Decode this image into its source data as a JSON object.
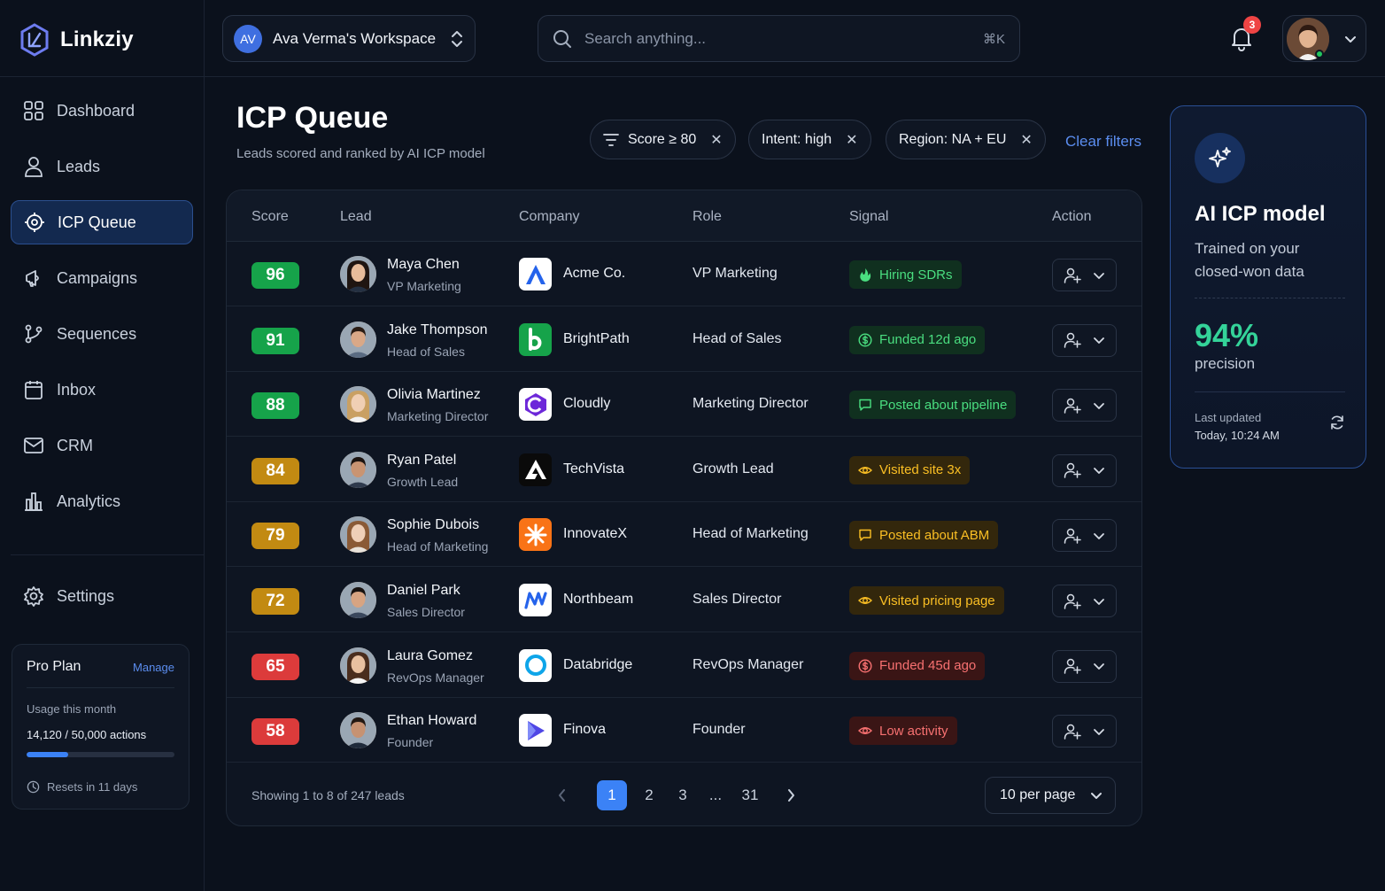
{
  "brand": {
    "name": "Linkziy"
  },
  "workspace": {
    "initials": "AV",
    "name": "Ava Verma's Workspace"
  },
  "search": {
    "placeholder": "Search anything...",
    "shortcut": "⌘K"
  },
  "notifications": {
    "count": "3"
  },
  "nav": {
    "items": [
      {
        "label": "Dashboard",
        "icon": "grid-icon"
      },
      {
        "label": "Leads",
        "icon": "user-icon"
      },
      {
        "label": "ICP Queue",
        "icon": "target-icon",
        "active": true
      },
      {
        "label": "Campaigns",
        "icon": "megaphone-icon"
      },
      {
        "label": "Sequences",
        "icon": "branch-icon"
      },
      {
        "label": "Inbox",
        "icon": "calendar-icon"
      },
      {
        "label": "CRM",
        "icon": "mail-icon"
      },
      {
        "label": "Analytics",
        "icon": "bar-chart-icon"
      }
    ],
    "settings": "Settings"
  },
  "plan": {
    "title": "Pro Plan",
    "manage": "Manage",
    "usage_label": "Usage this month",
    "usage": "14,120 / 50,000 actions",
    "usage_fraction": 0.2824,
    "reset": "Resets in 11 days"
  },
  "page": {
    "title": "ICP Queue",
    "subtitle": "Leads scored and ranked by AI ICP model"
  },
  "filters": {
    "chips": [
      "Score ≥ 80",
      "Intent: high",
      "Region: NA + EU"
    ],
    "clear": "Clear filters"
  },
  "table": {
    "headers": [
      "Score",
      "Lead",
      "Company",
      "Role",
      "Signal",
      "Action"
    ],
    "rows": [
      {
        "score": "96",
        "name": "Maya Chen",
        "title": "VP Marketing",
        "company": "Acme Co.",
        "role": "VP Marketing",
        "signal": "Hiring SDRs",
        "signal_icon": "flame-icon",
        "tone": "green"
      },
      {
        "score": "91",
        "name": "Jake Thompson",
        "title": "Head of Sales",
        "company": "BrightPath",
        "role": "Head of Sales",
        "signal": "Funded 12d ago",
        "signal_icon": "dollar-icon",
        "tone": "green"
      },
      {
        "score": "88",
        "name": "Olivia Martinez",
        "title": "Marketing Director",
        "company": "Cloudly",
        "role": "Marketing Director",
        "signal": "Posted about pipeline",
        "signal_icon": "comment-icon",
        "tone": "green"
      },
      {
        "score": "84",
        "name": "Ryan Patel",
        "title": "Growth Lead",
        "company": "TechVista",
        "role": "Growth Lead",
        "signal": "Visited site 3x",
        "signal_icon": "eye-icon",
        "tone": "amber"
      },
      {
        "score": "79",
        "name": "Sophie Dubois",
        "title": "Head of Marketing",
        "company": "InnovateX",
        "role": "Head of Marketing",
        "signal": "Posted about ABM",
        "signal_icon": "comment-icon",
        "tone": "amber"
      },
      {
        "score": "72",
        "name": "Daniel Park",
        "title": "Sales Director",
        "company": "Northbeam",
        "role": "Sales Director",
        "signal": "Visited pricing page",
        "signal_icon": "eye-icon",
        "tone": "amber"
      },
      {
        "score": "65",
        "name": "Laura Gomez",
        "title": "RevOps Manager",
        "company": "Databridge",
        "role": "RevOps Manager",
        "signal": "Funded 45d ago",
        "signal_icon": "dollar-icon",
        "tone": "red"
      },
      {
        "score": "58",
        "name": "Ethan Howard",
        "title": "Founder",
        "company": "Finova",
        "role": "Founder",
        "signal": "Low activity",
        "signal_icon": "eye-icon",
        "tone": "red"
      }
    ],
    "footer": {
      "showing": "Showing 1 to 8 of 247 leads",
      "pages": [
        "1",
        "2",
        "3",
        "...",
        "31"
      ],
      "per_page": "10 per page"
    }
  },
  "ai_card": {
    "title": "AI ICP model",
    "description": "Trained on your closed-won data",
    "metric": "94%",
    "metric_label": "precision",
    "updated_label": "Last updated",
    "updated": "Today, 10:24 AM"
  },
  "colors": {
    "accent": "#3b82f6",
    "score_green": "#16a34a",
    "score_amber": "#c28a12",
    "score_red": "#dc3b3b",
    "metric": "#34d399"
  }
}
